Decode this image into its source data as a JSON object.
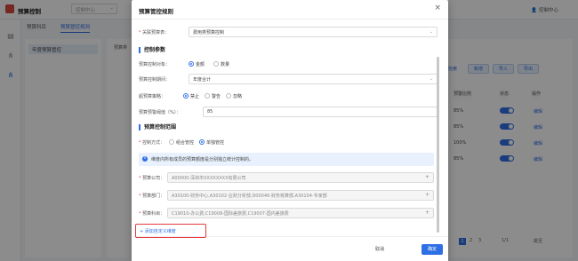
{
  "app": {
    "title": "预算控制",
    "org_select": "控制中心",
    "user": "控制中心"
  },
  "tabs": [
    "预算科目",
    "预算管控规则"
  ],
  "left_panel": {
    "label": "预算类",
    "item": "年度预算管控"
  },
  "background": {
    "buttons": [
      "新增",
      "导入",
      "导出"
    ],
    "btn_search": "检索",
    "columns": [
      "预警比例",
      "状态",
      "操作"
    ],
    "rows": [
      {
        "pct": "85%",
        "status": "开",
        "action": "编辑"
      },
      {
        "pct": "85%",
        "status": "开",
        "action": "编辑"
      },
      {
        "pct": "100%",
        "status": "开",
        "action": "编辑"
      },
      {
        "pct": "85%",
        "status": "开",
        "action": "编辑"
      }
    ],
    "pager": {
      "pages": [
        "1",
        "2",
        "3"
      ],
      "page_jump": "1/1",
      "goto": "跳至"
    }
  },
  "modal": {
    "title": "预算管控规则",
    "budget_table": {
      "label": "关联预算表：",
      "value": "费用类预算控制"
    },
    "section_params": "控制参数",
    "control_object": {
      "label": "预算控制对象：",
      "options": [
        "金额",
        "数量"
      ],
      "selected": 0
    },
    "control_period": {
      "label": "预算控制期间：",
      "value": "年度合计"
    },
    "over_strategy": {
      "label": "超预算策略：",
      "options": [
        "禁止",
        "警告",
        "忽略"
      ],
      "selected": 0
    },
    "warn_threshold": {
      "label": "预算预警阈值（%）：",
      "value": "85"
    },
    "section_scope": "预算控制范围",
    "control_mode": {
      "label": "控制方式：",
      "options": [
        "组合管控",
        "单独管控"
      ],
      "selected": 1
    },
    "info_text": "维度内所有成员的预算额度是分别独立统计控制的。",
    "company": {
      "label": "预算公司：",
      "value": "A00000-深圳市XXXXXXXX有限公司"
    },
    "department": {
      "label": "预算部门：",
      "value": "A30100-财务中心,A30102-业财分析部,D00046-财务核算部,A30104-专家部"
    },
    "subject": {
      "label": "预算科目：",
      "value": "C19010-办公费,C19008-国际差旅费,C19007-国内差旅费"
    },
    "add_dimension": "+ 添加自定义维度",
    "cancel": "取消",
    "confirm": "确定"
  }
}
